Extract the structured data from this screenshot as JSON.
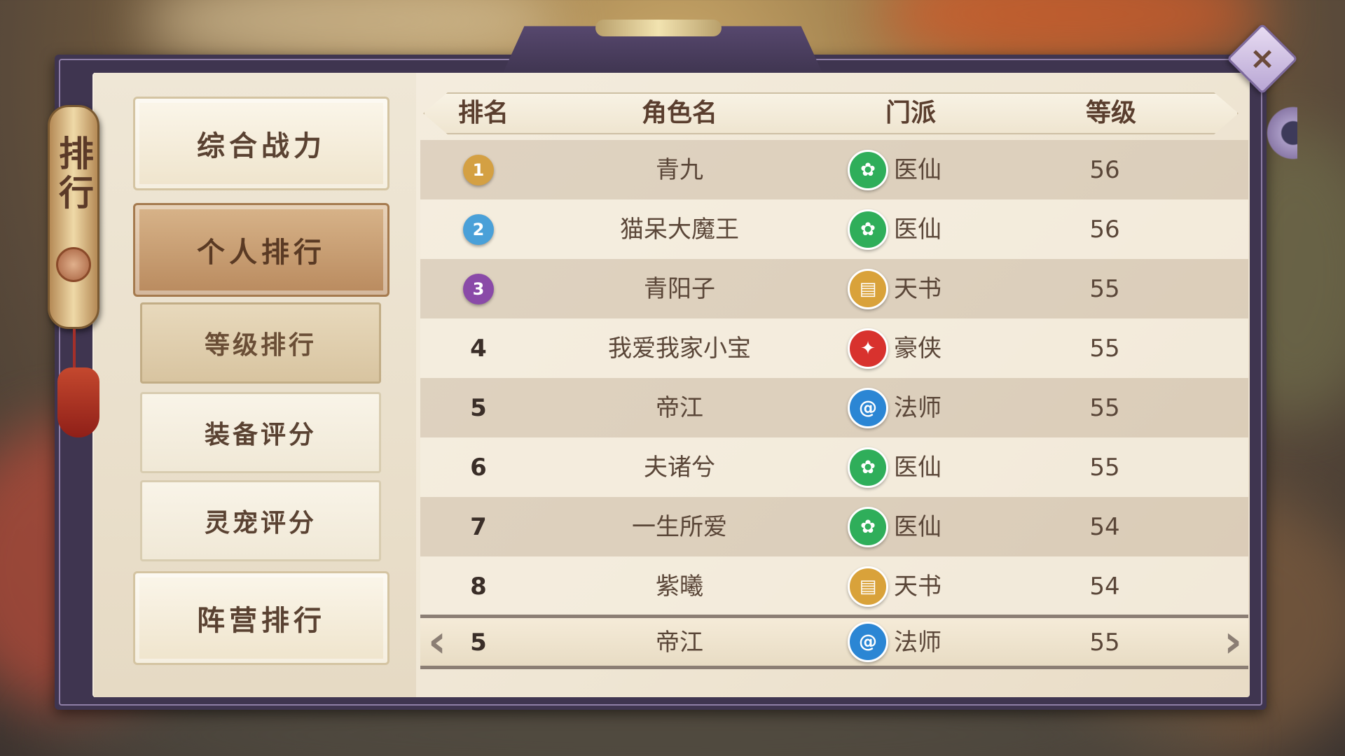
{
  "scroll_title": "排行",
  "close_icon": "×",
  "categories": {
    "combat_power": "综合战力",
    "personal_ranking": "个人排行",
    "faction_ranking": "阵营排行"
  },
  "sub_tabs": {
    "level": "等级排行",
    "equipment": "装备评分",
    "pet": "灵宠评分"
  },
  "table": {
    "headers": [
      "排名",
      "角色名",
      "门派",
      "等级"
    ],
    "rows": [
      {
        "rank": "1",
        "name": "青九",
        "sect": "医仙",
        "level": "56"
      },
      {
        "rank": "2",
        "name": "猫呆大魔王",
        "sect": "医仙",
        "level": "56"
      },
      {
        "rank": "3",
        "name": "青阳子",
        "sect": "天书",
        "level": "55"
      },
      {
        "rank": "4",
        "name": "我爱我家小宝",
        "sect": "豪侠",
        "level": "55"
      },
      {
        "rank": "5",
        "name": "帝江",
        "sect": "法师",
        "level": "55"
      },
      {
        "rank": "6",
        "name": "夫诸兮",
        "sect": "医仙",
        "level": "55"
      },
      {
        "rank": "7",
        "name": "一生所爱",
        "sect": "医仙",
        "level": "54"
      },
      {
        "rank": "8",
        "name": "紫曦",
        "sect": "天书",
        "level": "54"
      }
    ],
    "self_row": {
      "rank": "5",
      "name": "帝江",
      "sect": "法师",
      "level": "55"
    }
  },
  "sect_colors": {
    "医仙": "#2fae5a",
    "天书": "#d9a23a",
    "豪侠": "#d8322e",
    "法师": "#2b86d4"
  },
  "sect_glyphs": {
    "医仙": "✿",
    "天书": "▤",
    "豪侠": "✦",
    "法师": "@"
  },
  "medal_colors": [
    "#d4a043",
    "#4aa0d8",
    "#8a4aa8"
  ]
}
